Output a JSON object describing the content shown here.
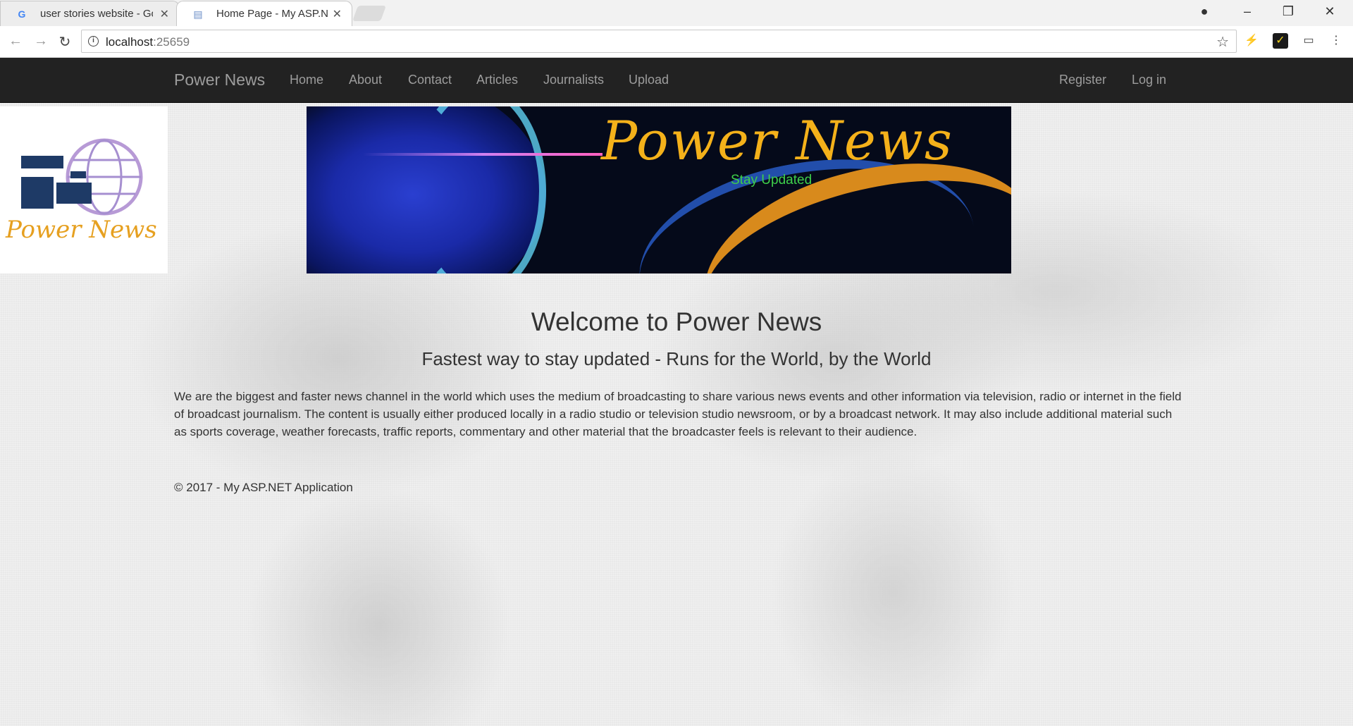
{
  "browser": {
    "tabs": [
      {
        "title": "user stories website - Go",
        "favicon": "google-g-icon",
        "active": false
      },
      {
        "title": "Home Page - My ASP.NE",
        "favicon": "page-icon",
        "active": true
      }
    ],
    "url_host": "localhost",
    "url_port": ":25659"
  },
  "navbar": {
    "brand": "Power News",
    "links": [
      "Home",
      "About",
      "Contact",
      "Articles",
      "Journalists",
      "Upload"
    ],
    "right_links": [
      "Register",
      "Log in"
    ]
  },
  "logo": {
    "text": "Power News"
  },
  "banner": {
    "title": "Power News",
    "tagline": "Stay Updated"
  },
  "main": {
    "heading": "Welcome to Power News",
    "subheading": "Fastest way to stay updated - Runs for the World, by the World",
    "paragraph": "We are the biggest and faster news channel in the world which uses the medium of broadcasting to share various news events and other information via television, radio or internet in the field of broadcast journalism. The content is usually either produced locally in a radio studio or television studio newsroom, or by a broadcast network. It may also include additional material such as sports coverage, weather forecasts, traffic reports, commentary and other material that the broadcaster feels is relevant to their audience."
  },
  "footer": {
    "text": "© 2017 - My ASP.NET Application"
  },
  "colors": {
    "navbar_bg": "#222222",
    "nav_link": "#9d9d9d",
    "banner_title": "#f4b11a",
    "banner_tag": "#3ecf4a"
  }
}
